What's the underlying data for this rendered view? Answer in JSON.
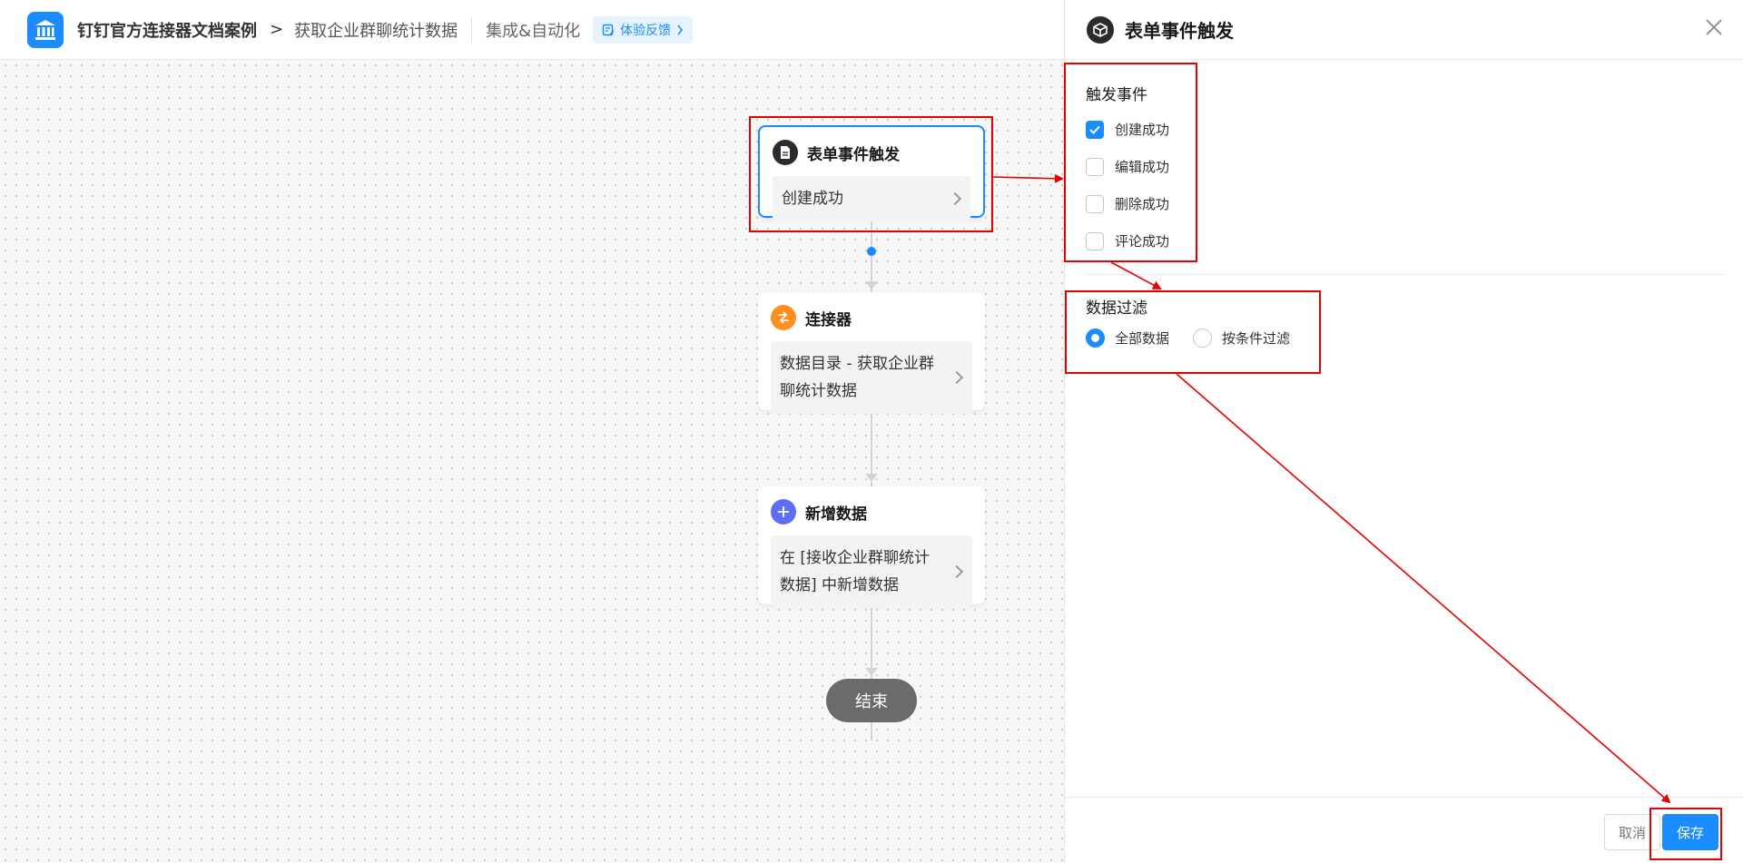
{
  "header": {
    "app_name": "钉钉官方连接器文档案例",
    "breadcrumb_separator": ">",
    "page_name": "获取企业群聊统计数据",
    "module": "集成&自动化",
    "feedback_label": "体验反馈"
  },
  "flow": {
    "nodes": [
      {
        "title": "表单事件触发",
        "body": "创建成功",
        "icon": "form-doc-icon",
        "icon_color": "#2b2b2b"
      },
      {
        "title": "连接器",
        "body": "数据目录 - 获取企业群聊统计数据",
        "icon": "connector-icon",
        "icon_color": "#ff8f1f"
      },
      {
        "title": "新增数据",
        "body": "在 [接收企业群聊统计数据] 中新增数据",
        "icon": "plus-icon",
        "icon_color": "#5b6ef5"
      }
    ],
    "end_label": "结束"
  },
  "panel": {
    "title": "表单事件触发",
    "trigger_section": {
      "title": "触发事件",
      "options": [
        {
          "label": "创建成功",
          "checked": true
        },
        {
          "label": "编辑成功",
          "checked": false
        },
        {
          "label": "删除成功",
          "checked": false
        },
        {
          "label": "评论成功",
          "checked": false
        }
      ]
    },
    "filter_section": {
      "title": "数据过滤",
      "options": [
        {
          "label": "全部数据",
          "selected": true
        },
        {
          "label": "按条件过滤",
          "selected": false
        }
      ]
    },
    "cancel_label": "取消",
    "save_label": "保存"
  },
  "colors": {
    "accent": "#1a8cff",
    "annotation": "#e60000"
  }
}
